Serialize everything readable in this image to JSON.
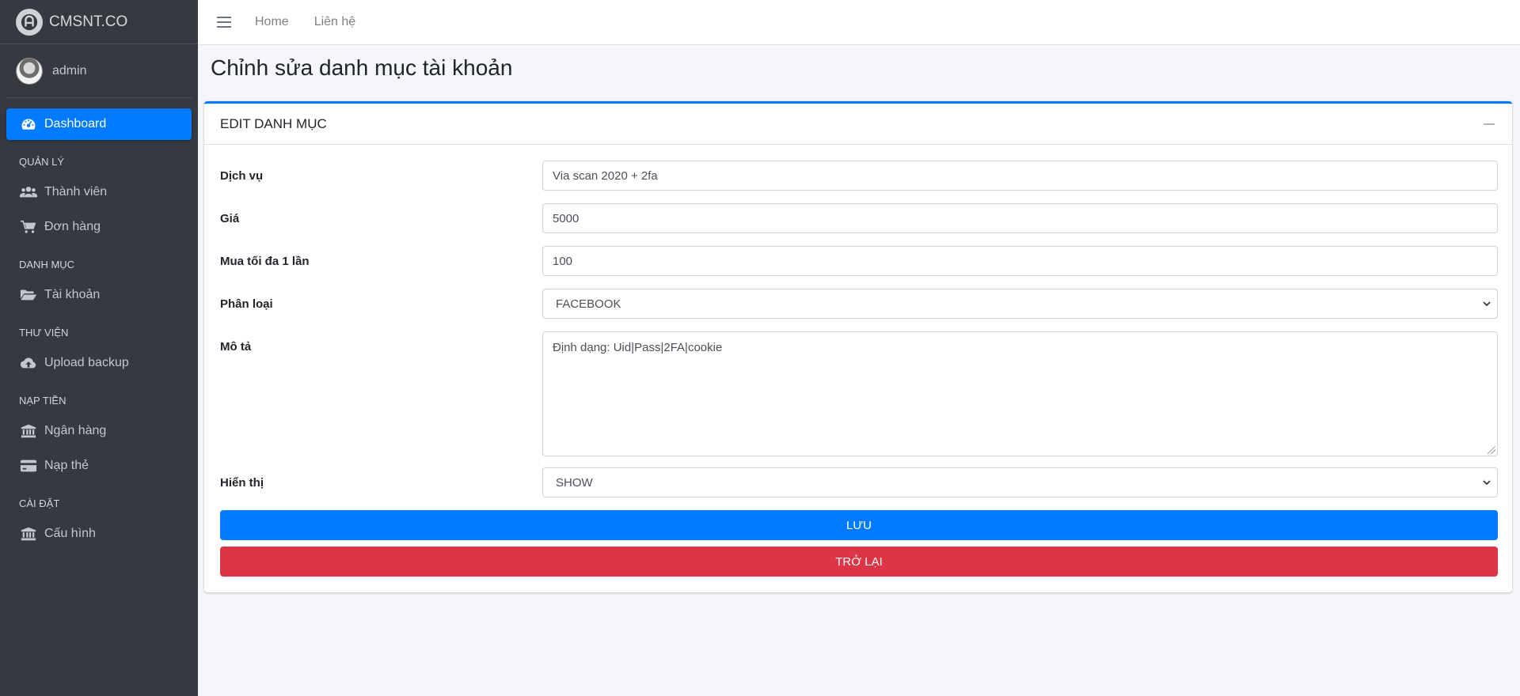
{
  "brand": {
    "name": "CMSNT.CO"
  },
  "user": {
    "name": "admin"
  },
  "sidebar": {
    "dashboard": "Dashboard",
    "sections": [
      {
        "header": "QUẢN LÝ",
        "items": [
          "Thành viên",
          "Đơn hàng"
        ]
      },
      {
        "header": "DANH MỤC",
        "items": [
          "Tài khoản"
        ]
      },
      {
        "header": "THƯ VIỆN",
        "items": [
          "Upload backup"
        ]
      },
      {
        "header": "NẠP TIỀN",
        "items": [
          "Ngân hàng",
          "Nạp thẻ"
        ]
      },
      {
        "header": "CÀI ĐẶT",
        "items": [
          "Cấu hình"
        ]
      }
    ]
  },
  "topnav": {
    "links": [
      "Home",
      "Liên hệ"
    ]
  },
  "page": {
    "title": "Chỉnh sửa danh mục tài khoản"
  },
  "card": {
    "title": "EDIT DANH MỤC"
  },
  "form": {
    "service": {
      "label": "Dịch vụ",
      "value": "Via scan 2020 + 2fa"
    },
    "price": {
      "label": "Giá",
      "value": "5000"
    },
    "max_buy": {
      "label": "Mua tối đa 1 lần",
      "value": "100"
    },
    "category": {
      "label": "Phân loại",
      "value": "FACEBOOK"
    },
    "description": {
      "label": "Mô tả",
      "value": "Định dạng: Uid|Pass|2FA|cookie"
    },
    "display": {
      "label": "Hiển thị",
      "value": "SHOW"
    }
  },
  "buttons": {
    "save": "LƯU",
    "back": "TRỞ LẠI"
  },
  "colors": {
    "sidebar_bg": "#343a40",
    "primary": "#007bff",
    "danger": "#dc3545",
    "content_bg": "#f4f6f9"
  }
}
